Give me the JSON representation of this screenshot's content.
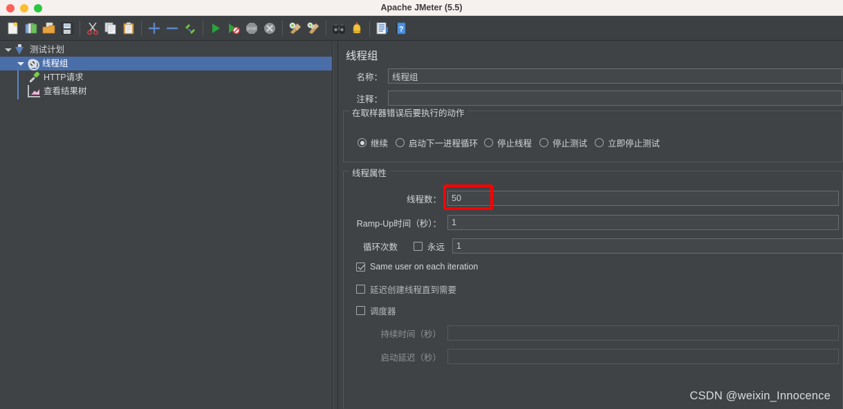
{
  "window": {
    "title": "Apache JMeter (5.5)",
    "traffic_lights": [
      "close-red",
      "minimize-amber",
      "maximize-green"
    ]
  },
  "toolbar": {
    "groups": [
      [
        {
          "name": "new-button",
          "icon": "new-file-icon",
          "tooltip": "New"
        },
        {
          "name": "templates-button",
          "icon": "templates-icon",
          "tooltip": "Templates"
        },
        {
          "name": "open-button",
          "icon": "open-folder-icon",
          "tooltip": "Open"
        },
        {
          "name": "save-button",
          "icon": "save-floppy-icon",
          "tooltip": "Save Test Plan"
        }
      ],
      [
        {
          "name": "cut-button",
          "icon": "scissors-icon",
          "tooltip": "Cut"
        },
        {
          "name": "copy-button",
          "icon": "copy-icon",
          "tooltip": "Copy"
        },
        {
          "name": "paste-button",
          "icon": "clipboard-paste-icon",
          "tooltip": "Paste"
        }
      ],
      [
        {
          "name": "expand-all-button",
          "icon": "plus-icon",
          "tooltip": "Expand All"
        },
        {
          "name": "collapse-all-button",
          "icon": "minus-icon",
          "tooltip": "Collapse All"
        },
        {
          "name": "toggle-button",
          "icon": "toggle-pencil-icon",
          "tooltip": "Toggle"
        }
      ],
      [
        {
          "name": "start-button",
          "icon": "play-green-icon",
          "tooltip": "Start"
        },
        {
          "name": "start-no-pauses-button",
          "icon": "play-no-pauses-icon",
          "tooltip": "Start no pauses"
        },
        {
          "name": "stop-button",
          "icon": "stop-sign-icon",
          "tooltip": "Stop"
        },
        {
          "name": "shutdown-button",
          "icon": "shutdown-x-icon",
          "tooltip": "Shutdown"
        }
      ],
      [
        {
          "name": "clear-button",
          "icon": "broom-icon",
          "tooltip": "Clear"
        },
        {
          "name": "clear-all-button",
          "icon": "double-broom-icon",
          "tooltip": "Clear All"
        }
      ],
      [
        {
          "name": "search-button",
          "icon": "binoculars-icon",
          "tooltip": "Search"
        },
        {
          "name": "reset-search-button",
          "icon": "bell-reset-icon",
          "tooltip": "Reset Search"
        }
      ],
      [
        {
          "name": "function-helper-button",
          "icon": "function-helper-icon",
          "tooltip": "Function Helper Dialog"
        },
        {
          "name": "help-button",
          "icon": "help-question-icon",
          "tooltip": "Help"
        }
      ]
    ]
  },
  "tree": {
    "nodes": [
      {
        "label": "测试计划",
        "icon": "test-plan-icon",
        "depth": 0,
        "expanded": true,
        "selected": false
      },
      {
        "label": "线程组",
        "icon": "thread-group-gear-icon",
        "depth": 1,
        "expanded": true,
        "selected": true
      },
      {
        "label": "HTTP请求",
        "icon": "http-request-pipette-icon",
        "depth": 2,
        "expanded": null,
        "selected": false
      },
      {
        "label": "查看结果树",
        "icon": "view-results-tree-icon",
        "depth": 2,
        "expanded": null,
        "selected": false
      }
    ]
  },
  "detail": {
    "title": "线程组",
    "name_label": "名称：",
    "name_value": "线程组",
    "comment_label": "注释：",
    "comment_value": "",
    "error_action": {
      "legend": "在取样器错误后要执行的动作",
      "options": [
        {
          "label": "继续",
          "selected": true
        },
        {
          "label": "启动下一进程循环",
          "selected": false
        },
        {
          "label": "停止线程",
          "selected": false
        },
        {
          "label": "停止测试",
          "selected": false
        },
        {
          "label": "立即停止测试",
          "selected": false
        }
      ]
    },
    "thread_props": {
      "legend": "线程属性",
      "threads_label": "线程数：",
      "threads_value": "50",
      "rampup_label": "Ramp-Up时间（秒）：",
      "rampup_value": "1",
      "loop_label": "循环次数",
      "forever_label": "永远",
      "forever_checked": false,
      "loop_value": "1",
      "same_user_label": "Same user on each iteration",
      "same_user_checked": true,
      "delay_create_label": "延迟创建线程直到需要",
      "delay_create_checked": false,
      "scheduler_label": "调度器",
      "scheduler_checked": false,
      "duration_label": "持续时间（秒）",
      "duration_value": "",
      "duration_disabled": true,
      "startup_delay_label": "启动延迟（秒）",
      "startup_delay_value": "",
      "startup_delay_disabled": true
    }
  },
  "annotation": {
    "highlight_target": "threads-count-input",
    "highlight_color": "#fe0000"
  },
  "watermark": {
    "text": "CSDN @weixin_Innocence"
  }
}
